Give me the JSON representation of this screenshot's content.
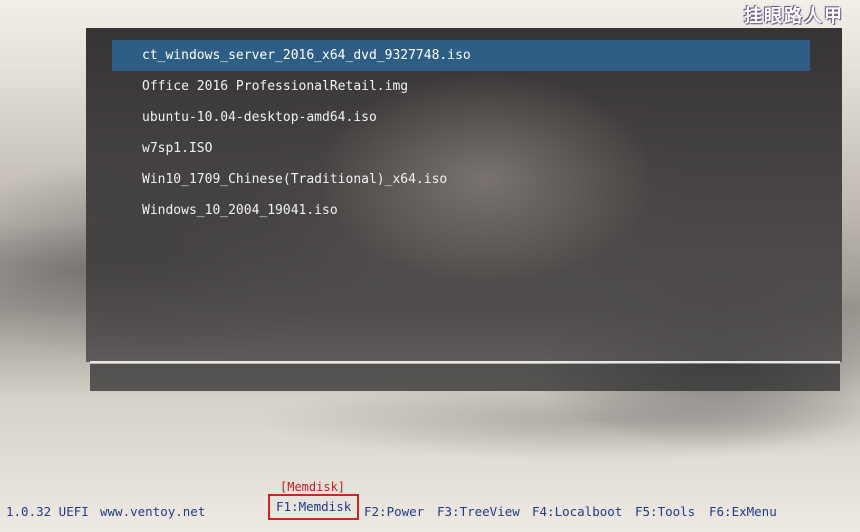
{
  "watermark": "挂眼路人甲",
  "menu": {
    "items": [
      "ct_windows_server_2016_x64_dvd_9327748.iso",
      "Office 2016 ProfessionalRetail.img",
      "ubuntu-10.04-desktop-amd64.iso",
      "w7sp1.ISO",
      "Win10_1709_Chinese(Traditional)_x64.iso",
      "Windows_10_2004_19041.iso"
    ],
    "selected_index": 0
  },
  "hint_label": "[Memdisk]",
  "footer": {
    "version": "1.0.32 UEFI",
    "site": "www.ventoy.net",
    "keys": {
      "f1": "F1:Memdisk",
      "f2": "F2:Power",
      "f3": "F3:TreeView",
      "f4": "F4:Localboot",
      "f5": "F5:Tools",
      "f6": "F6:ExMenu"
    }
  },
  "colors": {
    "selection": "#2e5e86",
    "footer_text": "#1f3a8a",
    "highlight_red": "#d02424"
  }
}
